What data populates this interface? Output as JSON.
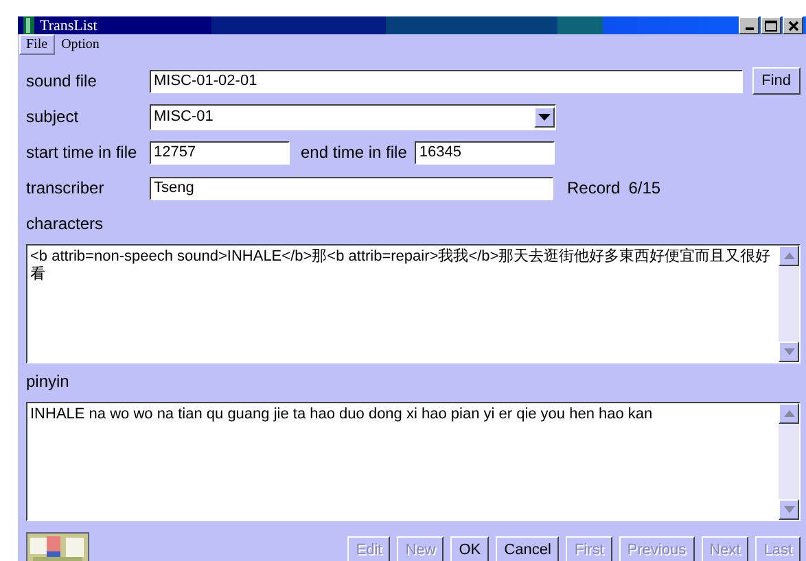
{
  "window": {
    "title": "TransList"
  },
  "menu": [
    {
      "label": "File",
      "selected": true
    },
    {
      "label": "Option",
      "selected": false
    }
  ],
  "sound_file": {
    "label": "sound file",
    "value": "MISC-01-02-01",
    "button": "Find"
  },
  "subject": {
    "label": "subject",
    "value": "MISC-01"
  },
  "start_time": {
    "label": "start time in file",
    "value": "12757"
  },
  "end_time": {
    "label": "end time in file",
    "value": "16345"
  },
  "transcriber": {
    "label": "transcriber",
    "value": "Tseng"
  },
  "record": {
    "label": "Record",
    "value": "6/15"
  },
  "characters": {
    "label": "characters",
    "value": "<b attrib=non-speech sound>INHALE</b>那<b attrib=repair>我我</b>那天去逛街他好多東西好便宜而且又很好看"
  },
  "pinyin": {
    "label": "pinyin",
    "value": "INHALE na wo wo na tian qu guang jie ta hao duo dong xi hao pian yi er qie you hen hao kan"
  },
  "buttons": [
    {
      "label": "Edit",
      "disabled": true
    },
    {
      "label": "New",
      "disabled": true
    },
    {
      "label": "OK",
      "disabled": false
    },
    {
      "label": "Cancel",
      "disabled": false
    },
    {
      "label": "First",
      "disabled": true
    },
    {
      "label": "Previous",
      "disabled": true
    },
    {
      "label": "Next",
      "disabled": true
    },
    {
      "label": "Last",
      "disabled": true
    }
  ]
}
